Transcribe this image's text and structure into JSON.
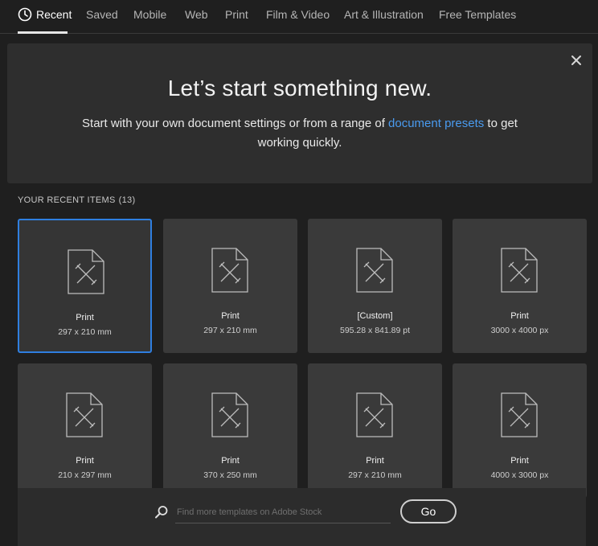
{
  "tabs": [
    {
      "label": "Recent",
      "active": true,
      "icon": "clock-icon"
    },
    {
      "label": "Saved"
    },
    {
      "label": "Mobile"
    },
    {
      "label": "Web"
    },
    {
      "label": "Print"
    },
    {
      "label": "Film & Video"
    },
    {
      "label": "Art & Illustration"
    },
    {
      "label": "Free Templates"
    }
  ],
  "hero": {
    "title": "Let’s start something new.",
    "subtitle_before": "Start with your own document settings or from a range of ",
    "subtitle_link": "document presets",
    "subtitle_after": " to get working quickly.",
    "close_icon": "close-icon"
  },
  "recent": {
    "header": "YOUR RECENT ITEMS",
    "count": "(13)",
    "items": [
      {
        "title": "Print",
        "dims": "297 x 210 mm",
        "selected": true
      },
      {
        "title": "Print",
        "dims": "297 x 210 mm"
      },
      {
        "title": "[Custom]",
        "dims": "595.28 x 841.89 pt"
      },
      {
        "title": "Print",
        "dims": "3000 x 4000 px"
      },
      {
        "title": "Print",
        "dims": "210 x 297 mm"
      },
      {
        "title": "Print",
        "dims": "370 x 250 mm"
      },
      {
        "title": "Print",
        "dims": "297 x 210 mm"
      },
      {
        "title": "Print",
        "dims": "4000 x 3000 px"
      }
    ]
  },
  "search": {
    "placeholder": "Find more templates on Adobe Stock",
    "value": "",
    "icon": "search-icon"
  },
  "go_button": {
    "label": "Go"
  },
  "colors": {
    "background": "#1f1f1f",
    "panel": "#2e2e2e",
    "card": "#3a3a3a",
    "selected_border": "#2f7fe0",
    "link": "#4a9bef"
  }
}
